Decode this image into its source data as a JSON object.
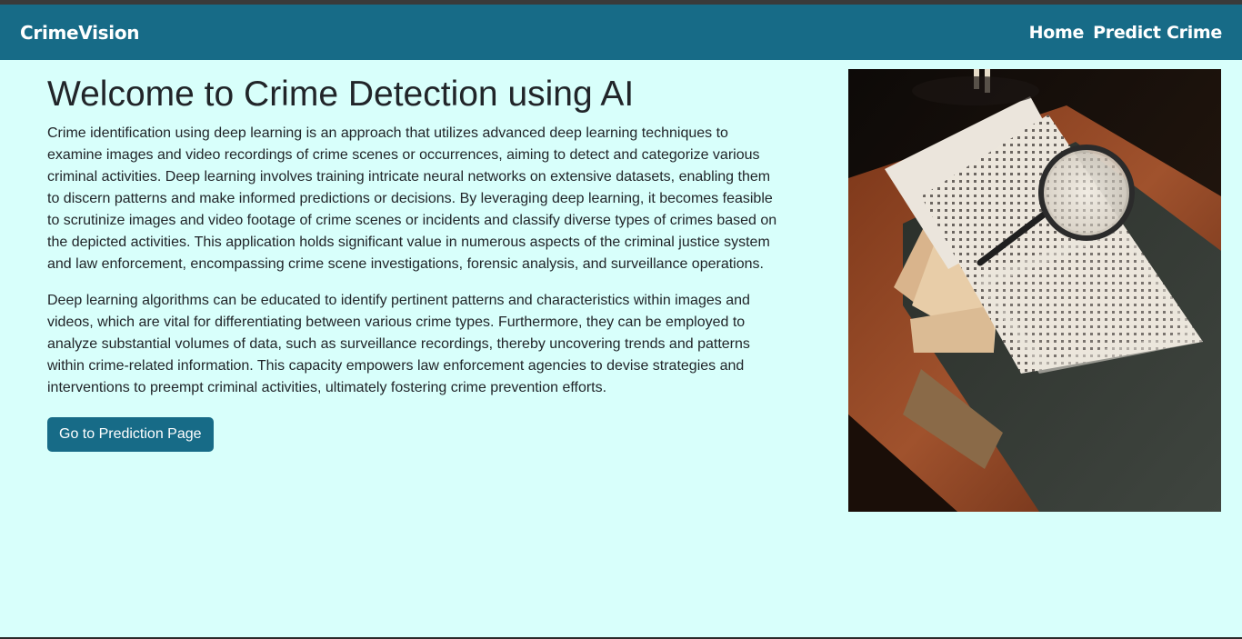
{
  "navbar": {
    "brand": "CrimeVision",
    "links": [
      {
        "label": "Home"
      },
      {
        "label": "Predict Crime"
      }
    ]
  },
  "main": {
    "title": "Welcome to Crime Detection using AI",
    "paragraphs": [
      "Crime identification using deep learning is an approach that utilizes advanced deep learning techniques to examine images and video recordings of crime scenes or occurrences, aiming to detect and categorize various criminal activities. Deep learning involves training intricate neural networks on extensive datasets, enabling them to discern patterns and make informed predictions or decisions. By leveraging deep learning, it becomes feasible to scrutinize images and video footage of crime scenes or incidents and classify diverse types of crimes based on the depicted activities. This application holds significant value in numerous aspects of the criminal justice system and law enforcement, encompassing crime scene investigations, forensic analysis, and surveillance operations.",
      "Deep learning algorithms can be educated to identify pertinent patterns and characteristics within images and videos, which are vital for differentiating between various crime types. Furthermore, they can be employed to analyze substantial volumes of data, such as surveillance recordings, thereby uncovering trends and patterns within crime-related information. This capacity empowers law enforcement agencies to devise strategies and interventions to preempt criminal activities, ultimately fostering crime prevention efforts."
    ],
    "cta_button": "Go to Prediction Page"
  },
  "colors": {
    "navbar_bg": "#176b87",
    "page_bg": "#d8fffb",
    "button_bg": "#176b87"
  }
}
